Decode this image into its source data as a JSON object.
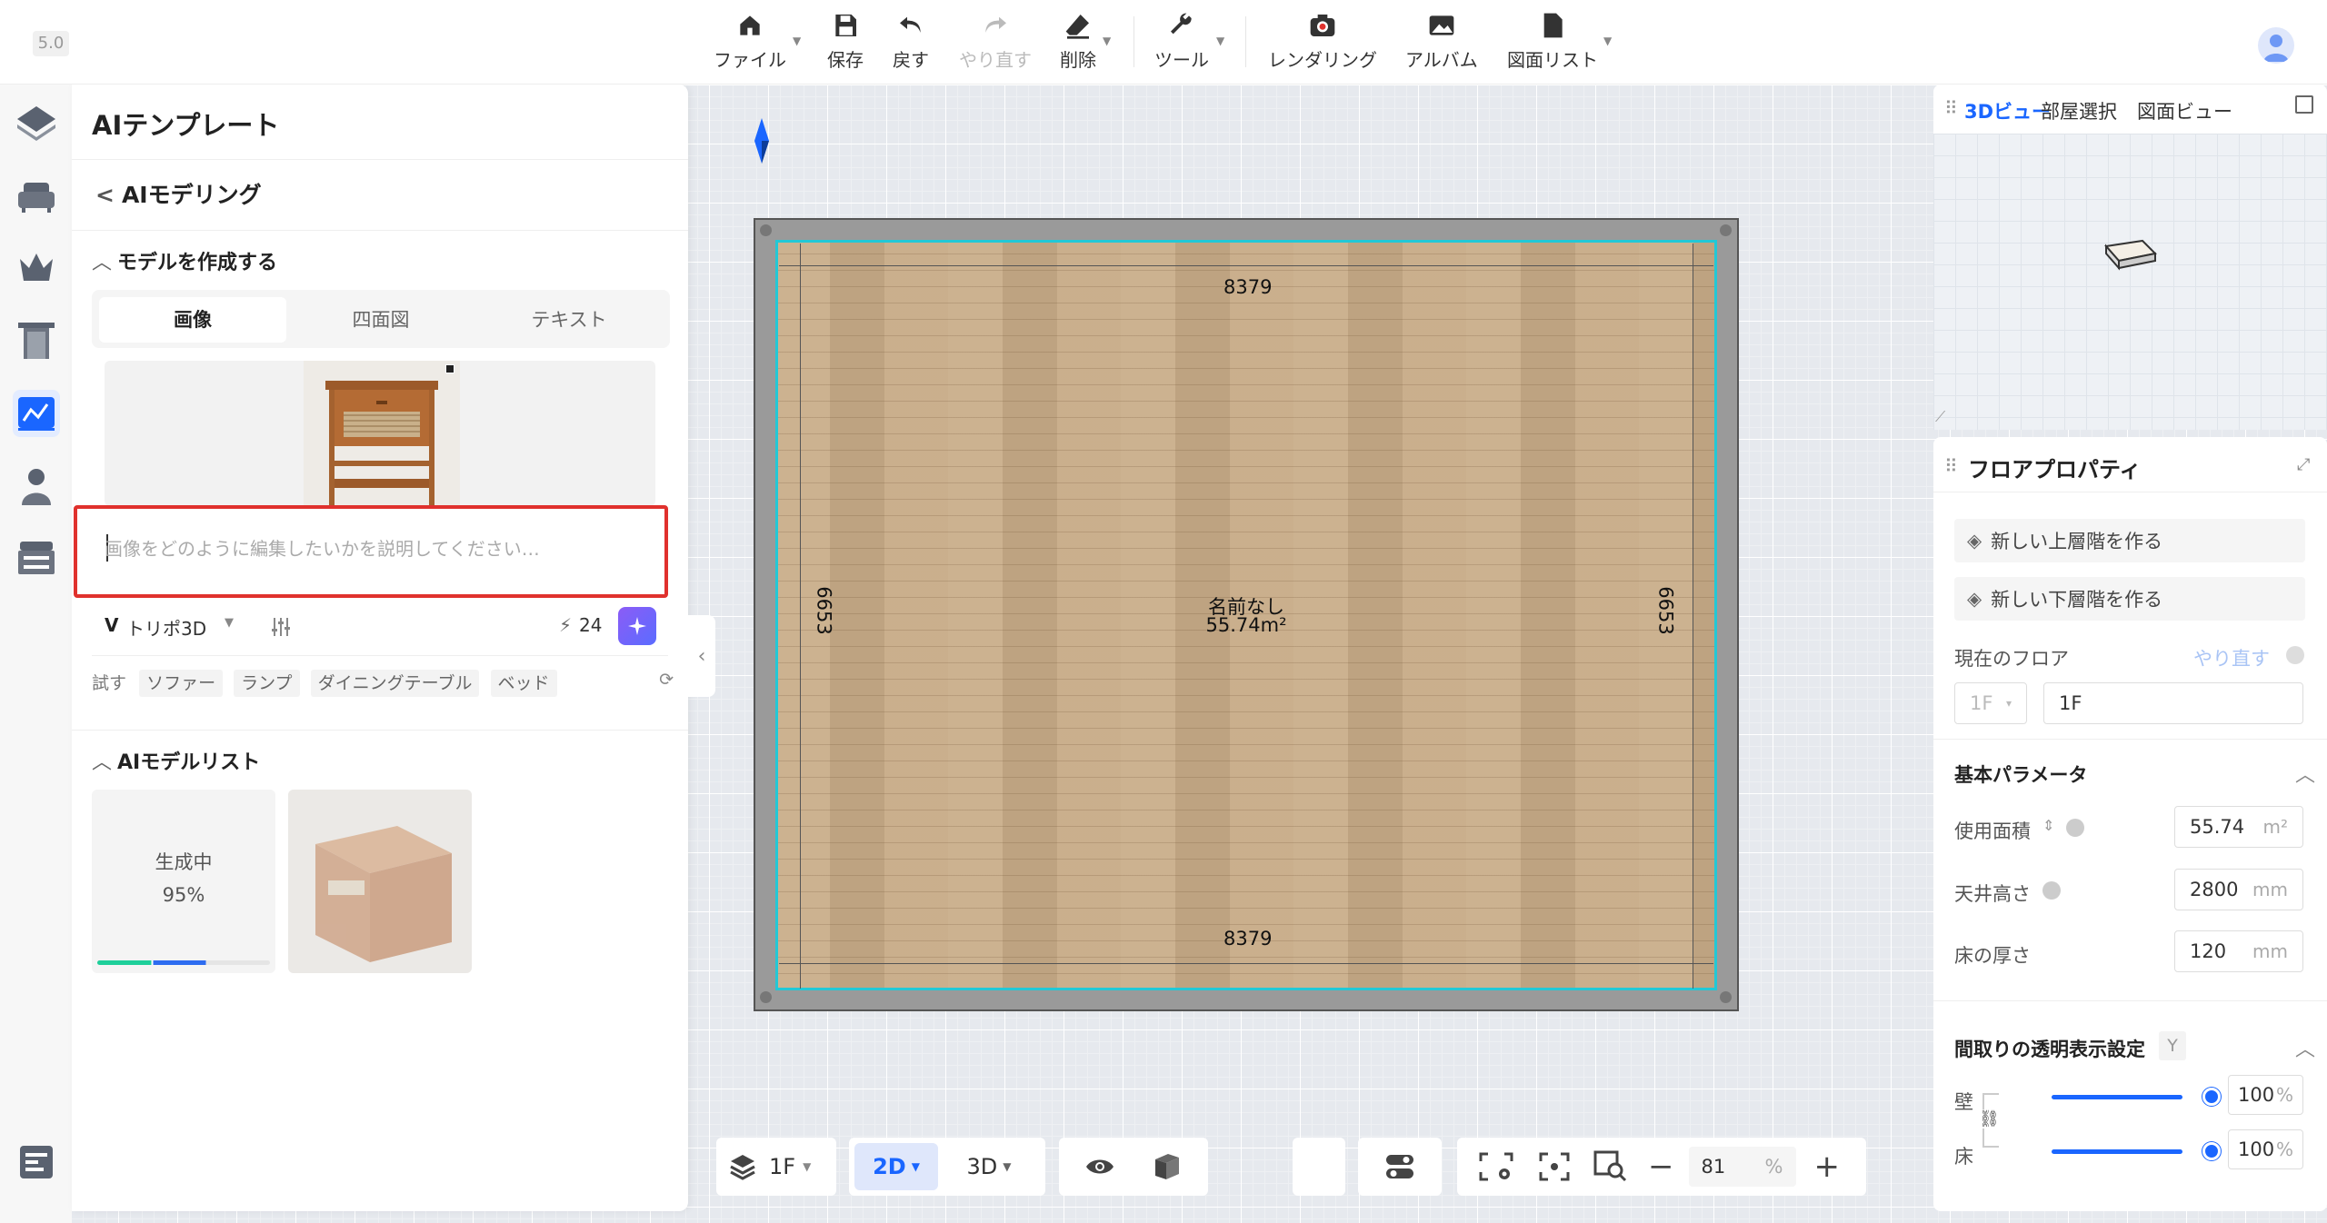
{
  "version": "5.0",
  "toolbar": {
    "file": "ファイル",
    "save": "保存",
    "undo": "戻す",
    "redo": "やり直す",
    "delete": "削除",
    "tools": "ツール",
    "rendering": "レンダリング",
    "album": "アルバム",
    "drawing_list": "図面リスト"
  },
  "left_panel": {
    "title": "AIテンプレート",
    "back_label": "AIモデリング",
    "create_section": "モデルを作成する",
    "tabs": [
      "画像",
      "四面図",
      "テキスト"
    ],
    "active_tab": "画像",
    "prompt_placeholder": "画像をどのように編集したいかを説明してください…",
    "model_select": "トリポ3D",
    "credits": "24",
    "try_label": "試す",
    "suggestions": [
      "ソファー",
      "ランプ",
      "ダイニングテーブル",
      "ベッド"
    ],
    "model_list_section": "AIモデルリスト",
    "generating_label": "生成中",
    "generating_percent": "95%",
    "generating_progress": 0.95
  },
  "floorplan": {
    "top_dimension": "8379",
    "bottom_dimension": "8379",
    "left_dimension": "6653",
    "right_dimension": "6653",
    "room_name": "名前なし",
    "room_area": "55.74m²"
  },
  "bottom_controls": {
    "floor": "1F",
    "view_2d": "2D",
    "view_3d": "3D",
    "zoom": "81",
    "zoom_unit": "%"
  },
  "right_panel": {
    "view_tabs": [
      "3Dビュー",
      "部屋選択",
      "図面ビュー"
    ],
    "active_view_tab": "3Dビュー",
    "floor_props_title": "フロアプロパティ",
    "add_upper": "新しい上層階を作る",
    "add_lower": "新しい下層階を作る",
    "current_floor_label": "現在のフロア",
    "redo_label": "やり直す",
    "floor_select": "1F",
    "floor_name": "1F",
    "basic_params": "基本パラメータ",
    "area_label": "使用面積",
    "area_value": "55.74",
    "area_unit": "m²",
    "ceiling_label": "天井高さ",
    "ceiling_value": "2800",
    "ceiling_unit": "mm",
    "floor_thickness_label": "床の厚さ",
    "floor_thickness_value": "120",
    "floor_thickness_unit": "mm",
    "transparency_title": "間取りの透明表示設定",
    "transparency_key": "Y",
    "wall_label": "壁",
    "wall_value": "100",
    "floor_label": "床",
    "floor_value": "100",
    "percent": "%"
  },
  "colors": {
    "accent": "#1a66ff",
    "room_outline": "#22c8d6",
    "highlight": "#e0312d"
  }
}
